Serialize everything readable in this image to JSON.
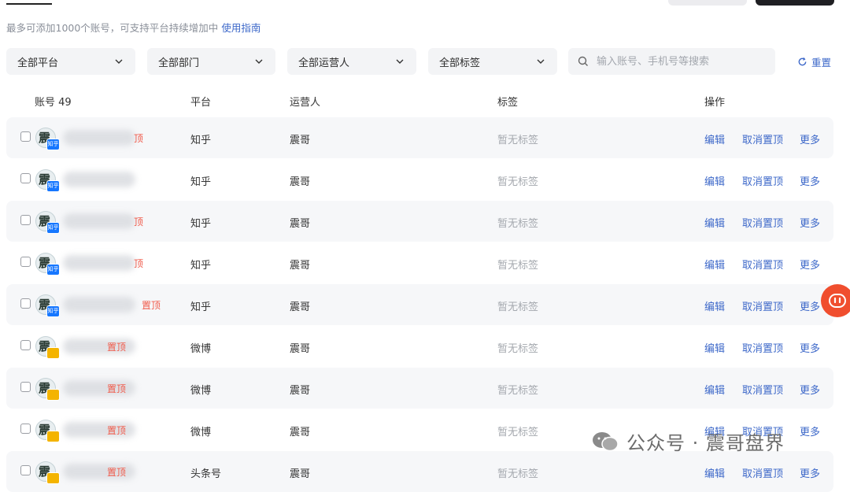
{
  "notice": {
    "text": "最多可添加1000个账号，可支持平台持续增加中",
    "link": "使用指南"
  },
  "filters": {
    "platform": "全部平台",
    "department": "全部部门",
    "operator": "全部运营人",
    "tag": "全部标签"
  },
  "search": {
    "placeholder": "输入账号、手机号等搜索",
    "value": ""
  },
  "reset_label": "重置",
  "columns": {
    "account": "账号 49",
    "platform": "平台",
    "operator": "运营人",
    "tag": "标签",
    "action": "操作"
  },
  "rows": [
    {
      "pin": "顶",
      "platform": "知乎",
      "operator": "震哥",
      "tag": "暂无标签",
      "edit": "编辑",
      "unpin": "取消置顶",
      "more": "更多",
      "badge": "知乎"
    },
    {
      "pin": "",
      "platform": "知乎",
      "operator": "震哥",
      "tag": "暂无标签",
      "edit": "编辑",
      "unpin": "取消置顶",
      "more": "更多",
      "badge": "知乎"
    },
    {
      "pin": "顶",
      "platform": "知乎",
      "operator": "震哥",
      "tag": "暂无标签",
      "edit": "编辑",
      "unpin": "取消置顶",
      "more": "更多",
      "badge": "知乎"
    },
    {
      "pin": "顶",
      "platform": "知乎",
      "operator": "震哥",
      "tag": "暂无标签",
      "edit": "编辑",
      "unpin": "取消置顶",
      "more": "更多",
      "badge": "知乎"
    },
    {
      "pin": "置顶",
      "platform": "知乎",
      "operator": "震哥",
      "tag": "暂无标签",
      "edit": "编辑",
      "unpin": "取消置顶",
      "more": "更多",
      "badge": "知乎"
    },
    {
      "pin": "置顶",
      "platform": "微博",
      "operator": "震哥",
      "tag": "暂无标签",
      "edit": "编辑",
      "unpin": "取消置顶",
      "more": "更多",
      "badge": ""
    },
    {
      "pin": "置顶",
      "platform": "微博",
      "operator": "震哥",
      "tag": "暂无标签",
      "edit": "编辑",
      "unpin": "取消置顶",
      "more": "更多",
      "badge": ""
    },
    {
      "pin": "置顶",
      "platform": "微博",
      "operator": "震哥",
      "tag": "暂无标签",
      "edit": "编辑",
      "unpin": "取消置顶",
      "more": "更多",
      "badge": ""
    },
    {
      "pin": "置顶",
      "platform": "头条号",
      "operator": "震哥",
      "tag": "暂无标签",
      "edit": "编辑",
      "unpin": "取消置顶",
      "more": "更多",
      "badge": ""
    }
  ],
  "watermark": "公众号 · 震哥盘界",
  "colors": {
    "link": "#3d68c9",
    "pin": "#f05a4a",
    "float": "#f04e2e",
    "row_alt": "#f6f7f9"
  }
}
